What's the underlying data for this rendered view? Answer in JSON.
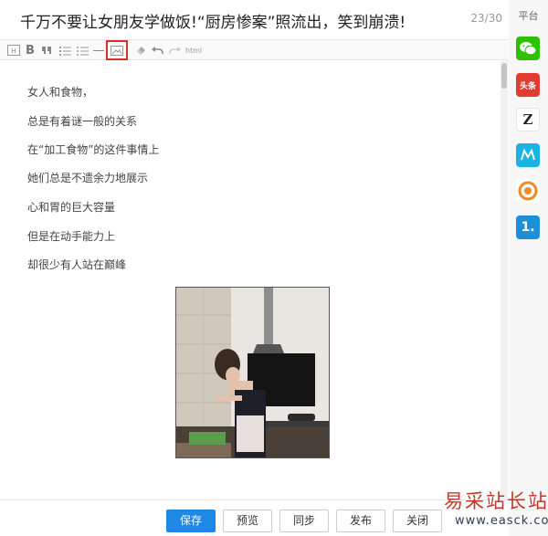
{
  "title": {
    "text": "千万不要让女朋友学做饭!“厨房惨案”照流出，笑到崩溃!",
    "count": "23/30"
  },
  "toolbar": {
    "html_label": "html",
    "highlighted": "image-button"
  },
  "content": {
    "paragraphs": [
      "女人和食物，",
      "总是有着谜一般的关系",
      "在“加工食物”的这件事情上",
      "她们总是不遗余力地展示",
      "心和胃的巨大容量",
      "但是在动手能力上",
      "却很少有人站在巅峰"
    ]
  },
  "sidebar": {
    "title": "平台",
    "platforms": [
      {
        "icon": "wechat-icon",
        "color": "#2dc100"
      },
      {
        "icon": "toutiao-icon",
        "label": "头条",
        "color": "#e03c31"
      },
      {
        "icon": "zaker-icon",
        "label": "Z",
        "color": "#222222"
      },
      {
        "icon": "platform-m-icon",
        "color": "#1ab3e6"
      },
      {
        "icon": "platform-o-icon",
        "color": "#f08a24"
      },
      {
        "icon": "yidian-icon",
        "label": "1.",
        "color": "#1d8fd8"
      }
    ]
  },
  "footer": {
    "save": "保存",
    "preview": "预览",
    "sync": "同步",
    "publish": "发布",
    "close": "关闭"
  },
  "watermark": {
    "text": "易采站长站",
    "url": "www.easck.com"
  }
}
